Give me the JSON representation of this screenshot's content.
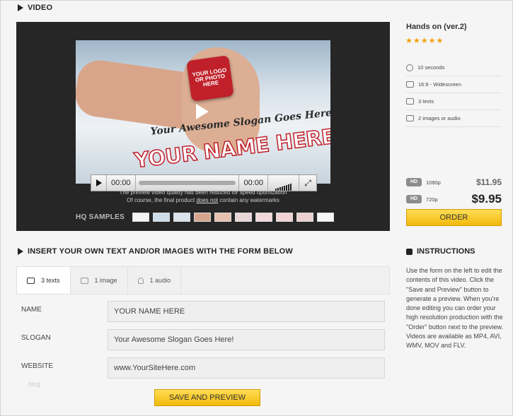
{
  "video_section": {
    "title": "VIDEO",
    "player": {
      "logo_lines": [
        "YOUR LOGO",
        "OR PHOTO",
        "HERE"
      ],
      "slogan": "Your Awesome Slogan Goes Here!",
      "name": "YOUR NAME HERE",
      "time_current": "00:00",
      "time_total": "00:00"
    },
    "notice_line1": "The preview video quality has been reduced for speed optimization",
    "notice_line2_prefix": "Of course, the final product ",
    "notice_line2_underlined": "does not",
    "notice_line2_suffix": " contain any watermarks",
    "hq_samples_label": "HQ SAMPLES"
  },
  "product": {
    "title": "Hands on (ver.2)",
    "rating": "★★★★★",
    "specs": [
      {
        "icon": "clock-icon",
        "text": "10 seconds"
      },
      {
        "icon": "monitor-icon",
        "text": "16:9 - Widescreen"
      },
      {
        "icon": "speech-bubble-icon",
        "text": "3 texts"
      },
      {
        "icon": "camera-icon",
        "text": "2 images or audio"
      }
    ],
    "prices": [
      {
        "badge": "HD",
        "resolution": "1080p",
        "price": "$11.95"
      },
      {
        "badge": "HD",
        "resolution": "720p",
        "price": "$9.95"
      }
    ],
    "order_label": "ORDER"
  },
  "form_section": {
    "title": "INSERT YOUR OWN TEXT AND/OR IMAGES WITH THE FORM BELOW",
    "tabs": [
      {
        "label": "3 texts",
        "icon": "speech-bubble-icon"
      },
      {
        "label": "1 image",
        "icon": "camera-icon"
      },
      {
        "label": "1 audio",
        "icon": "music-note-icon"
      }
    ],
    "fields": [
      {
        "label": "NAME",
        "value": "YOUR NAME HERE"
      },
      {
        "label": "SLOGAN",
        "value": "Your Awesome Slogan Goes Here!"
      },
      {
        "label": "WEBSITE",
        "value": "www.YourSiteHere.com"
      }
    ],
    "blog_text": "blog",
    "save_label": "SAVE AND PREVIEW"
  },
  "instructions": {
    "title": "INSTRUCTIONS",
    "text": "Use the form on the left to edit the contents of this video. Click the \"Save and Preview\" button to generate a preview. When you're done editing you can order your high resolution production with the \"Order\" button next to the preview. Videos are available as MP4, AVI, WMV, MOV and FLV."
  },
  "colors": {
    "accent": "#f2b90c",
    "stars": "#f2a10d",
    "video_bg": "#262626"
  }
}
